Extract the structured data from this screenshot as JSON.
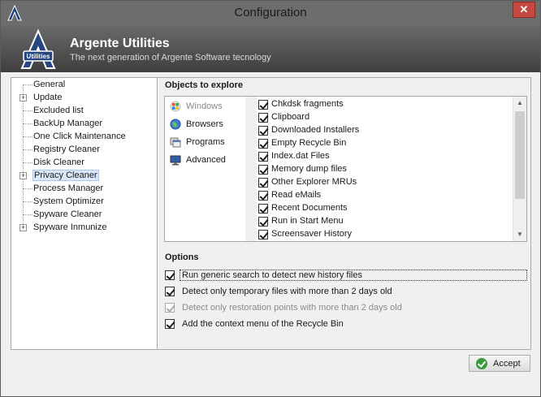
{
  "window": {
    "title": "Configuration",
    "close_glyph": "✕"
  },
  "header": {
    "brand": "Argente Utilities",
    "tagline": "The next generation of Argente Software tecnology",
    "logo_text": "Utilities"
  },
  "tree": {
    "items": [
      {
        "label": "General",
        "expandable": false
      },
      {
        "label": "Update",
        "expandable": true
      },
      {
        "label": "Excluded list",
        "expandable": false
      },
      {
        "label": "BackUp Manager",
        "expandable": false
      },
      {
        "label": "One Click Maintenance",
        "expandable": false
      },
      {
        "label": "Registry Cleaner",
        "expandable": false
      },
      {
        "label": "Disk Cleaner",
        "expandable": false
      },
      {
        "label": "Privacy Cleaner",
        "expandable": true,
        "selected": true
      },
      {
        "label": "Process Manager",
        "expandable": false
      },
      {
        "label": "System Optimizer",
        "expandable": false
      },
      {
        "label": "Spyware Cleaner",
        "expandable": false
      },
      {
        "label": "Spyware Inmunize",
        "expandable": true
      }
    ]
  },
  "explore": {
    "title": "Objects to explore",
    "categories": [
      {
        "label": "Windows",
        "icon": "windows-icon",
        "active": true
      },
      {
        "label": "Browsers",
        "icon": "globe-icon"
      },
      {
        "label": "Programs",
        "icon": "programs-icon"
      },
      {
        "label": "Advanced",
        "icon": "computer-icon"
      }
    ],
    "items": [
      {
        "label": "Chkdsk fragments",
        "checked": true
      },
      {
        "label": "Clipboard",
        "checked": true
      },
      {
        "label": "Downloaded Installers",
        "checked": true
      },
      {
        "label": "Empty Recycle Bin",
        "checked": true
      },
      {
        "label": "Index.dat Files",
        "checked": true
      },
      {
        "label": "Memory dump files",
        "checked": true
      },
      {
        "label": "Other Explorer MRUs",
        "checked": true
      },
      {
        "label": "Read eMails",
        "checked": true
      },
      {
        "label": "Recent Documents",
        "checked": true
      },
      {
        "label": "Run in Start Menu",
        "checked": true
      },
      {
        "label": "Screensaver History",
        "checked": true
      }
    ],
    "scroll_up_glyph": "▲",
    "scroll_down_glyph": "▼"
  },
  "options": {
    "title": "Options",
    "items": [
      {
        "label": "Run generic search to detect new history files",
        "checked": true,
        "focused": true
      },
      {
        "label": "Detect only temporary files with more than 2 days old",
        "checked": true
      },
      {
        "label": "Detect only restoration points with more than 2 days old",
        "checked": true,
        "disabled": true
      },
      {
        "label": "Add the context menu of the Recycle Bin",
        "checked": true
      }
    ]
  },
  "footer": {
    "accept_label": "Accept"
  },
  "colors": {
    "titlebar": "#6d6d6d",
    "header_top": "#6a6a6a",
    "header_bottom": "#3f3f3f",
    "close_button": "#c7483f",
    "accept_icon": "#3a9a3a"
  }
}
